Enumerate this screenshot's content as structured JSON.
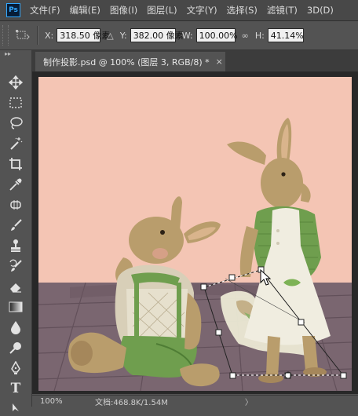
{
  "app": {
    "logo": "Ps"
  },
  "menu": [
    "文件(F)",
    "编辑(E)",
    "图像(I)",
    "图层(L)",
    "文字(Y)",
    "选择(S)",
    "滤镜(T)",
    "3D(D)"
  ],
  "options": {
    "x_label": "X:",
    "x_value": "318.50 像素",
    "delta_icon": "△",
    "y_label": "Y:",
    "y_value": "382.00 像素",
    "w_label": "W:",
    "w_value": "100.00%",
    "link_icon": "∞",
    "h_label": "H:",
    "h_value": "41.14%"
  },
  "document": {
    "tab_title": "制作投影.psd @ 100% (图层 3, RGB/8) *",
    "close_glyph": "×"
  },
  "status": {
    "zoom": "100%",
    "doc_size": "文档:468.8K/1.54M",
    "arrow": "〉"
  },
  "colors": {
    "background": "#f4c5b4",
    "floor": "#7a6670",
    "rabbit_body": "#b99d6c",
    "green_clothes": "#6f9e4e",
    "white_dress": "#f0ede0",
    "shadow": "#e9e7d2"
  },
  "toolbar_icons": [
    "move-icon",
    "marquee-icon",
    "lasso-icon",
    "magic-wand-icon",
    "crop-icon",
    "eyedropper-icon",
    "healing-brush-icon",
    "brush-icon",
    "clone-stamp-icon",
    "history-brush-icon",
    "eraser-icon",
    "gradient-icon",
    "blur-icon",
    "dodge-icon",
    "pen-icon",
    "type-icon",
    "path-select-icon"
  ]
}
